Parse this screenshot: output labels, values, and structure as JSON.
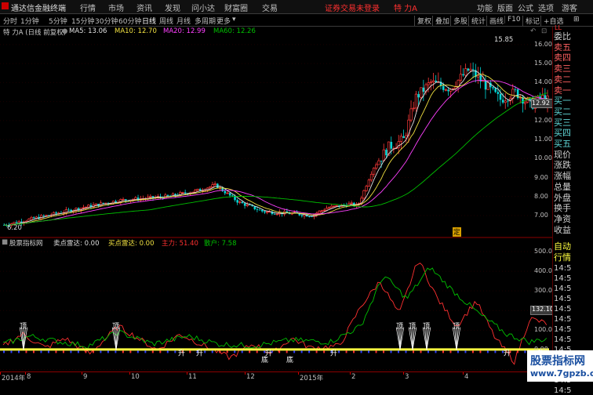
{
  "app": {
    "logo_text": "通达信金融终端",
    "menu": [
      "行情",
      "市场",
      "资讯",
      "发现",
      "问小达",
      "财富圈",
      "交易"
    ],
    "login_status": "证券交易未登录",
    "stock_title": "特 力A",
    "right_menu": [
      "功能",
      "版面",
      "公式",
      "选项",
      "游客"
    ]
  },
  "toolbar": {
    "periods": [
      "分时",
      "1分钟",
      "5分钟",
      "15分钟",
      "30分钟",
      "60分钟",
      "日线",
      "周线",
      "月线",
      "多周期",
      "更多"
    ],
    "right_tools": [
      "复权",
      "叠加",
      "多股",
      "统计",
      "画线",
      "F10",
      "标记",
      "+自选"
    ],
    "corner_icons": [
      "↶",
      "⊡"
    ]
  },
  "info_bar": {
    "stock": "特 力A (日线 前复权)",
    "ma5_label": "MA5: 13.06",
    "ma10_label": "MA10: 12.70",
    "ma20_label": "MA20: 12.99",
    "ma60_label": "MA60: 12.26"
  },
  "price_axis": {
    "ticks": [
      "16.00",
      "15.00",
      "14.00",
      "13.00",
      "12.00",
      "11.00",
      "10.00",
      "9.00",
      "8.00",
      "7.00"
    ],
    "current_price": "12.92",
    "max_label": "15.85",
    "min_label": "6.20",
    "marker": "定"
  },
  "indicator": {
    "name": "股票指标网",
    "sell_radar": "卖点雷达: 0.00",
    "buy_radar": "买点雷达: 0.00",
    "main_force": "主力: 51.40",
    "retail": "散户: 7.58",
    "ticks": [
      "500.0",
      "400.0",
      "300.0",
      "200.0",
      "100.0",
      "0.00",
      "-100.0"
    ],
    "current": "132.10",
    "signal_top": "顶",
    "signal_up": "升",
    "signal_bottom": "底"
  },
  "time_axis": {
    "labels": [
      "2014年",
      "8",
      "9",
      "10",
      "11",
      "12",
      "2015年",
      "2",
      "3",
      "4"
    ]
  },
  "side_panel": {
    "top_label": "LL",
    "labels": [
      "委比",
      "卖五",
      "卖四",
      "卖三",
      "卖二",
      "卖一",
      "买一",
      "买二",
      "买三",
      "买四",
      "买五",
      "现价",
      "涨跌",
      "涨幅",
      "总量",
      "外盘",
      "换手",
      "净资",
      "收益"
    ],
    "lower_labels": [
      "自动",
      "行情"
    ],
    "times": [
      "14:5",
      "14:5",
      "14:5",
      "14:5",
      "14:5",
      "14:5",
      "14:5",
      "14:5",
      "14:5",
      "14:5",
      "14:5",
      "14:5",
      "14:5"
    ]
  },
  "watermark": {
    "title": "股票指标网",
    "url": "www.7gpzb.com"
  },
  "chart_data": [
    {
      "type": "candlestick",
      "title": "特 力A 日线",
      "y_range": [
        6.0,
        16.5
      ],
      "ma": {
        "MA5": 13.06,
        "MA10": 12.7,
        "MA20": 12.99,
        "MA60": 12.26
      },
      "high": 15.85,
      "low": 6.2,
      "colors": {
        "up": "#ff3a3a",
        "down": "#00d8d8",
        "ma5": "#e0e0e0",
        "ma10": "#f0e040",
        "ma20": "#ff40ff",
        "ma60": "#00c000"
      }
    },
    {
      "type": "line",
      "title": "股票指标网",
      "y_range": [
        -100,
        520
      ],
      "series": [
        {
          "name": "主力",
          "value": 51.4,
          "color": "#ff3030"
        },
        {
          "name": "散户",
          "value": 7.58,
          "color": "#00c000"
        }
      ]
    }
  ]
}
